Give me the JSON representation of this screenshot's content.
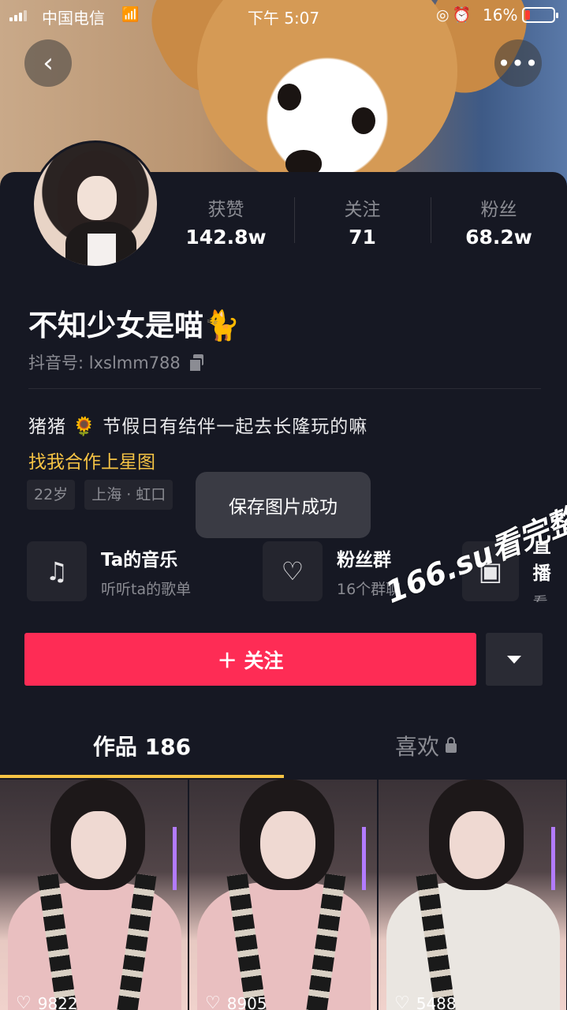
{
  "status_bar": {
    "carrier": "中国电信",
    "time": "下午 5:07",
    "battery": "16%",
    "icons": [
      "wifi-icon",
      "rotation-lock-icon",
      "alarm-icon"
    ]
  },
  "nav": {
    "back_icon": "‹",
    "more_icon": "•••"
  },
  "profile": {
    "stats": [
      {
        "label": "获赞",
        "value": "142.8w"
      },
      {
        "label": "关注",
        "value": "71"
      },
      {
        "label": "粉丝",
        "value": "68.2w"
      }
    ],
    "nickname": "不知少女是喵🐈",
    "account": "抖音号: lxslmm788",
    "bio": "猪猪 🌻 节假日有结伴一起去长隆玩的嘛",
    "cooperate": "找我合作上星图",
    "tags": [
      "22岁",
      "上海 · 虹口"
    ]
  },
  "toast": "保存图片成功",
  "features": [
    {
      "icon": "music-note-icon",
      "title": "Ta的音乐",
      "subtitle": "听听ta的歌单"
    },
    {
      "icon": "fans-group-icon",
      "title": "粉丝群",
      "subtitle": "16个群聊"
    },
    {
      "icon": "tv-icon",
      "title": "直播",
      "subtitle": "看"
    }
  ],
  "actions": {
    "follow_label": "＋ 关注"
  },
  "watermark": "166.su看完整版",
  "tabs": [
    {
      "label": "作品 186",
      "active": true
    },
    {
      "label": "喜欢",
      "active": false,
      "locked": true
    }
  ],
  "videos": [
    {
      "likes": "9822"
    },
    {
      "likes": "8905"
    },
    {
      "likes": "5488"
    }
  ],
  "colors": {
    "background": "#161823",
    "accent": "#fe2c55",
    "highlight": "#f5c344",
    "muted_text": "#8b8c93"
  }
}
